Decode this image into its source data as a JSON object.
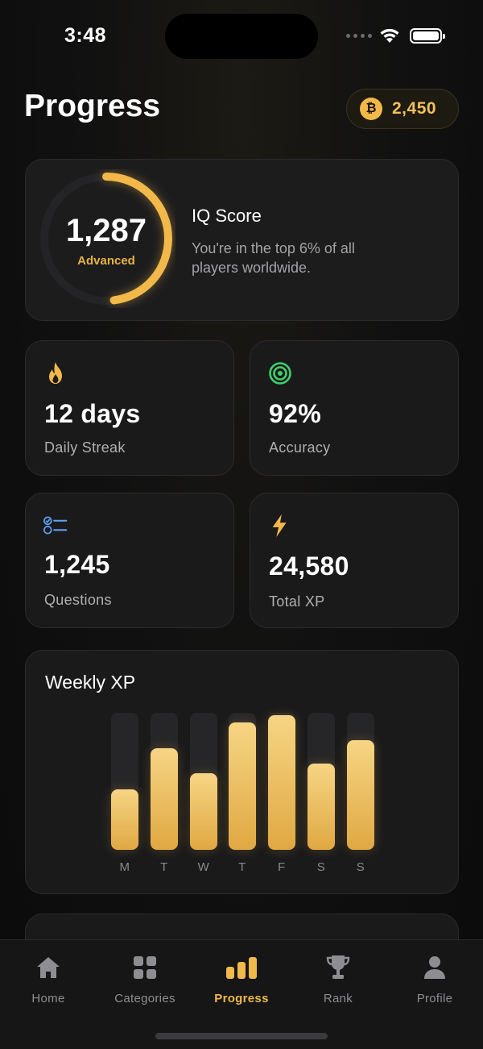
{
  "status_bar": {
    "time": "3:48"
  },
  "header": {
    "title": "Progress",
    "coins": "2,450",
    "coin_symbol": "₿"
  },
  "iq_card": {
    "score": "1,287",
    "level": "Advanced",
    "title": "IQ Score",
    "description": "You're in the top 6% of all players worldwide.",
    "ring_progress": 0.48
  },
  "stats": [
    {
      "value": "12 days",
      "label": "Daily Streak",
      "icon": "flame-icon",
      "color": "#f2b94a"
    },
    {
      "value": "92%",
      "label": "Accuracy",
      "icon": "target-icon",
      "color": "#3ecf6a"
    },
    {
      "value": "1,245",
      "label": "Questions",
      "icon": "checklist-icon",
      "color": "#5aa0f0"
    },
    {
      "value": "24,580",
      "label": "Total XP",
      "icon": "lightning-icon",
      "color": "#f2b94a"
    }
  ],
  "weekly_xp": {
    "title": "Weekly XP",
    "chart_data": {
      "type": "bar",
      "categories": [
        "M",
        "T",
        "W",
        "T",
        "F",
        "S",
        "S"
      ],
      "values": [
        0.44,
        0.74,
        0.56,
        0.93,
        0.98,
        0.63,
        0.8
      ]
    }
  },
  "tabs": [
    {
      "label": "Home",
      "icon": "home-icon",
      "active": false
    },
    {
      "label": "Categories",
      "icon": "grid-icon",
      "active": false
    },
    {
      "label": "Progress",
      "icon": "bar-chart-icon",
      "active": true
    },
    {
      "label": "Rank",
      "icon": "trophy-icon",
      "active": false
    },
    {
      "label": "Profile",
      "icon": "person-icon",
      "active": false
    }
  ],
  "colors": {
    "accent": "#f2b94a",
    "background": "#0b0b0c",
    "card": "#1a1a1b"
  }
}
